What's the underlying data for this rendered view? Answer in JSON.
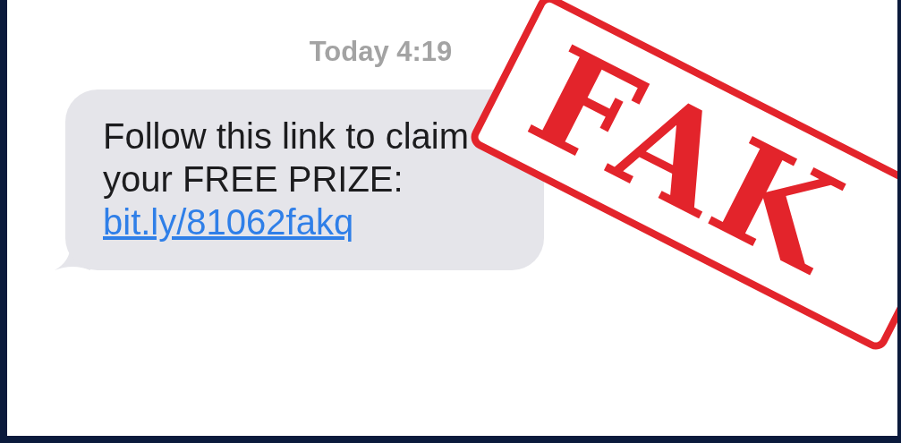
{
  "timestamp": "Today 4:19",
  "message": {
    "text": "Follow this link to claim your FREE PRIZE:",
    "link": "bit.ly/81062fakq"
  },
  "stamp": {
    "text": "FAK"
  }
}
